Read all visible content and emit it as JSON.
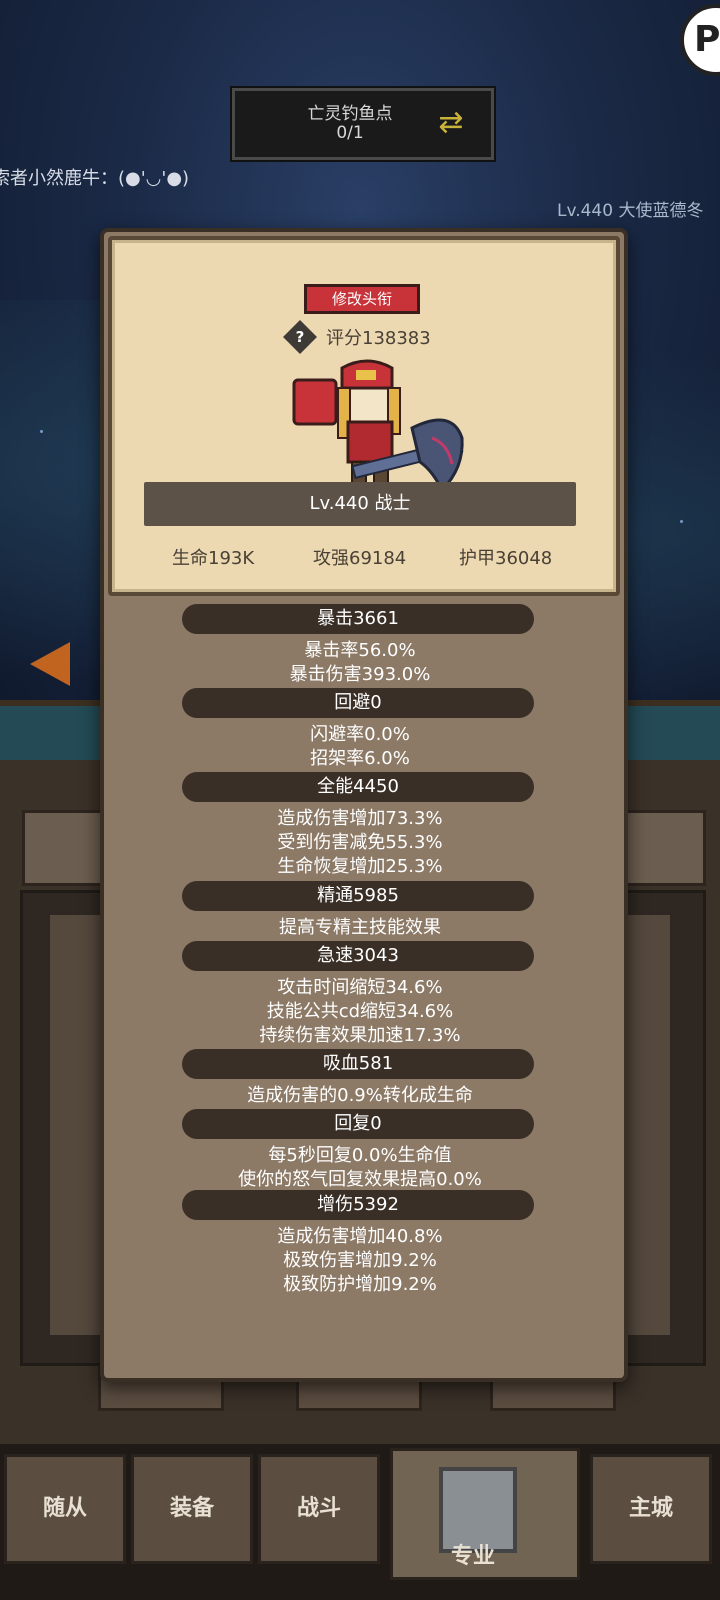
{
  "quest": {
    "title": "亡灵钓鱼点",
    "progress": "0/1"
  },
  "chat": {
    "message": "索者小然鹿牛：(●'◡'●)"
  },
  "other_player": "Lv.440 大使蓝德冬",
  "corner_badge": "P",
  "profile": {
    "rename_button": "修改头衔",
    "score": "评分138383",
    "level": "Lv.440 战士",
    "hp": "生命193K",
    "attack": "攻强69184",
    "armor": "护甲36048"
  },
  "attributes": [
    {
      "header": "暴击3661",
      "lines": [
        "暴击率56.0%",
        "暴击伤害393.0%"
      ]
    },
    {
      "header": "回避0",
      "lines": [
        "闪避率0.0%",
        "招架率6.0%"
      ]
    },
    {
      "header": "全能4450",
      "lines": [
        "造成伤害增加73.3%",
        "受到伤害减免55.3%",
        "生命恢复增加25.3%"
      ]
    },
    {
      "header": "精通5985",
      "lines": [
        "提高专精主技能效果"
      ]
    },
    {
      "header": "急速3043",
      "lines": [
        "攻击时间缩短34.6%",
        "技能公共cd缩短34.6%",
        "持续伤害效果加速17.3%"
      ]
    },
    {
      "header": "吸血581",
      "lines": [
        "造成伤害的0.9%转化成生命"
      ]
    },
    {
      "header": "回复0",
      "lines": [
        "每5秒回复0.0%生命值",
        "使你的怒气回复效果提高0.0%"
      ]
    },
    {
      "header": "增伤5392",
      "lines": [
        "造成伤害增加40.8%",
        "极致伤害增加9.2%",
        "极致防护增加9.2%"
      ]
    }
  ],
  "nav": {
    "items": [
      {
        "label": "随从"
      },
      {
        "label": "装备"
      },
      {
        "label": "战斗"
      },
      {
        "label": "专业"
      },
      {
        "label": "主城"
      }
    ],
    "active": "专业"
  }
}
